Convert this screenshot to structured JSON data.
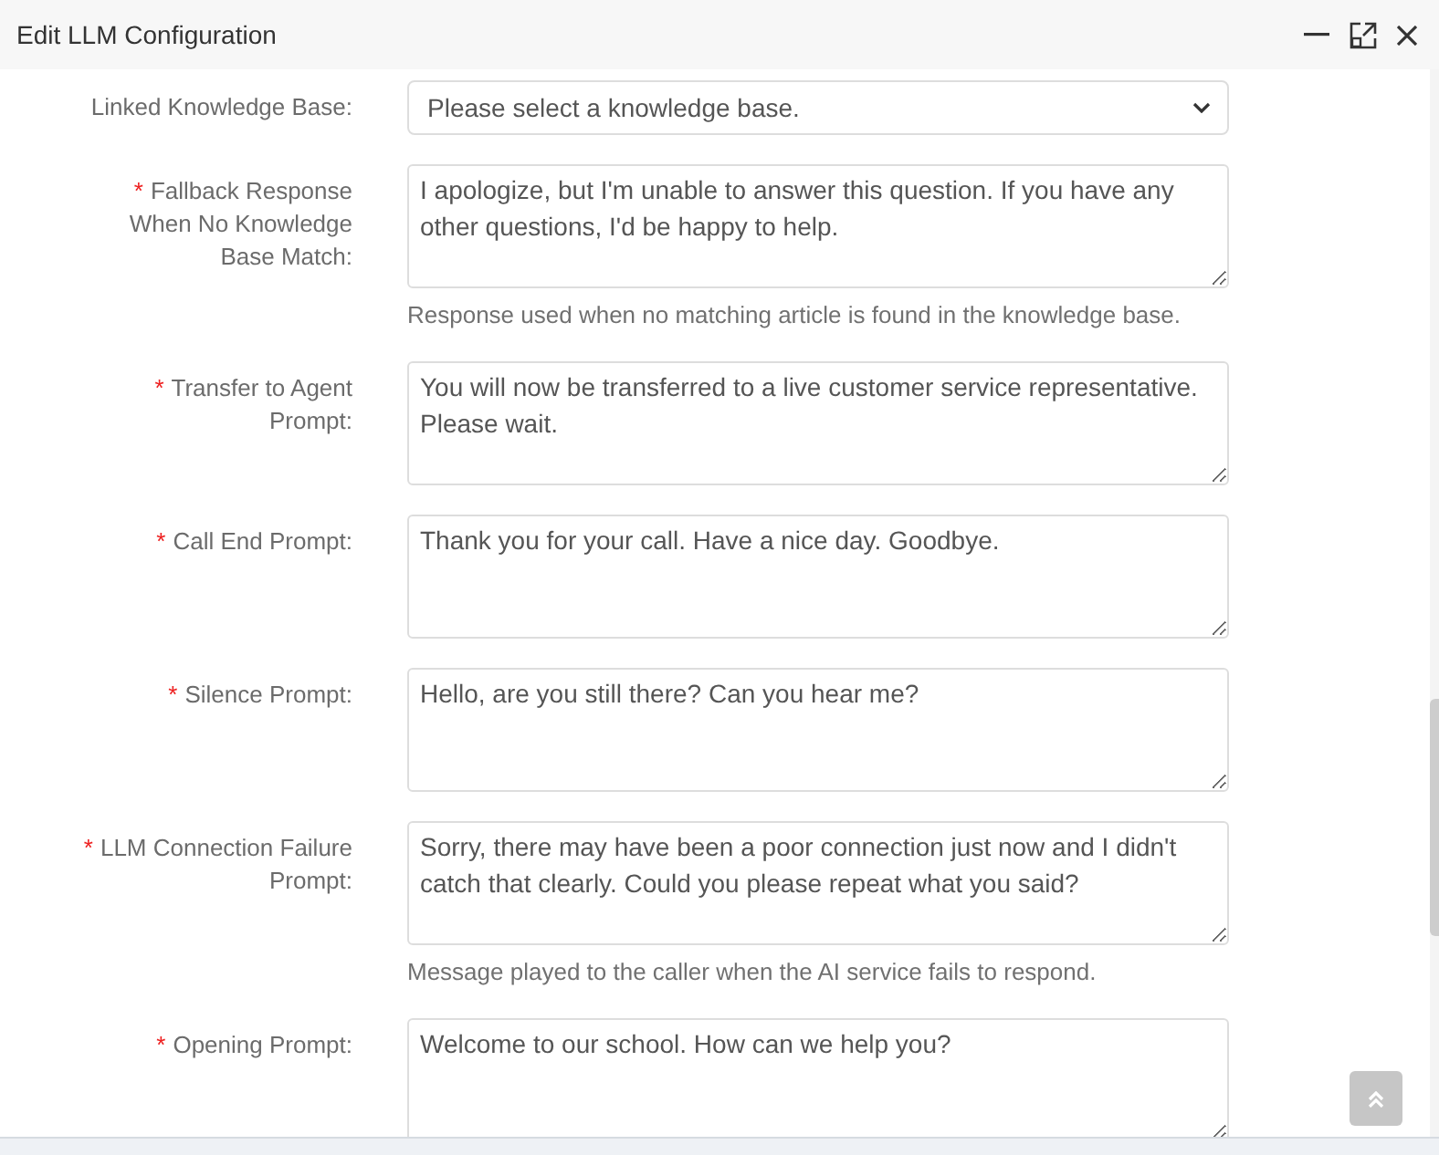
{
  "window": {
    "title": "Edit LLM Configuration"
  },
  "form": {
    "fields": [
      {
        "kind": "select",
        "label": "Linked Knowledge Base:",
        "value": "Please select a knowledge base."
      },
      {
        "kind": "textarea",
        "required_mark": "*",
        "label": "Fallback Response When No Knowledge Base Match:",
        "value": "I apologize, but I'm unable to answer this question. If you have any other questions, I'd be happy to help.",
        "help": "Response used when no matching article is found in the knowledge base."
      },
      {
        "kind": "textarea",
        "required_mark": "*",
        "label": "Transfer to Agent Prompt:",
        "value": "You will now be transferred to a live customer service representative. Please wait."
      },
      {
        "kind": "textarea",
        "required_mark": "*",
        "label": "Call End Prompt:",
        "value": "Thank you for your call. Have a nice day. Goodbye."
      },
      {
        "kind": "textarea",
        "required_mark": "*",
        "label": "Silence Prompt:",
        "value": "Hello, are you still there? Can you hear me?"
      },
      {
        "kind": "textarea",
        "required_mark": "*",
        "label": "LLM Connection Failure Prompt:",
        "value": "Sorry, there may have been a poor connection just now and I didn't catch that clearly. Could you please repeat what you said?",
        "help": "Message played to the caller when the AI service fails to respond."
      },
      {
        "kind": "textarea",
        "required_mark": "*",
        "label": "Opening Prompt:",
        "value": "Welcome to our school. How can we help you?"
      }
    ]
  }
}
